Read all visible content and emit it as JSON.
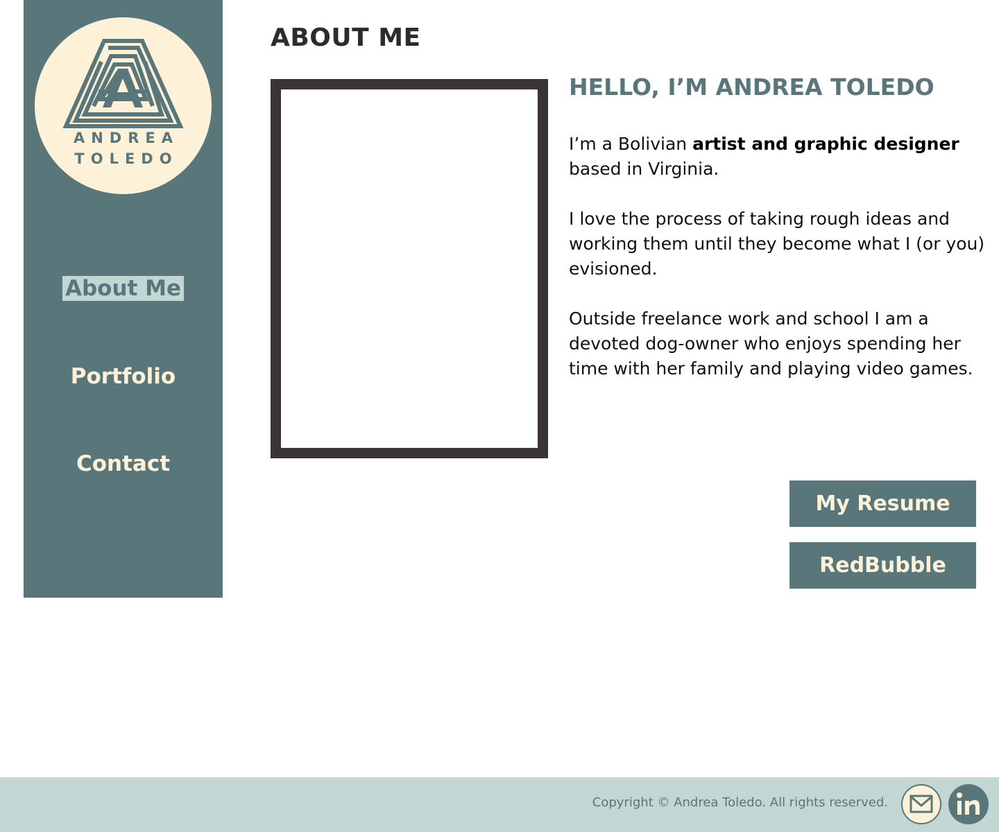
{
  "brand": {
    "logo_first": "ANDREA",
    "logo_second": "TOLEDO",
    "logo_icon": "maze-a-icon"
  },
  "nav": {
    "items": [
      {
        "label": "About Me",
        "active": true
      },
      {
        "label": "Portfolio",
        "active": false
      },
      {
        "label": "Contact",
        "active": false
      }
    ]
  },
  "main": {
    "heading": "ABOUT ME",
    "greeting": "HELLO, I’M ANDREA TOLEDO",
    "bio": {
      "p1_before": "I’m a Bolivian ",
      "p1_bold": "artist and graphic designer",
      "p1_after": " based in Virginia.",
      "p2": "I love the process of taking rough ideas and working them until they become what I (or you) evisioned.",
      "p3": "Outside freelance work and school I am a devoted dog-owner who enjoys spending her time with her family and playing video games."
    },
    "buttons": {
      "resume": "My Resume",
      "redbubble": "RedBubble"
    }
  },
  "footer": {
    "copyright": "Copyright © Andrea Toledo. All rights reserved.",
    "icons": [
      "mail-icon",
      "linkedin-icon"
    ]
  },
  "colors": {
    "sidebar": "#59777a",
    "cream": "#fdf1d7",
    "footer": "#c2d7d3",
    "frame": "#3a3435"
  }
}
